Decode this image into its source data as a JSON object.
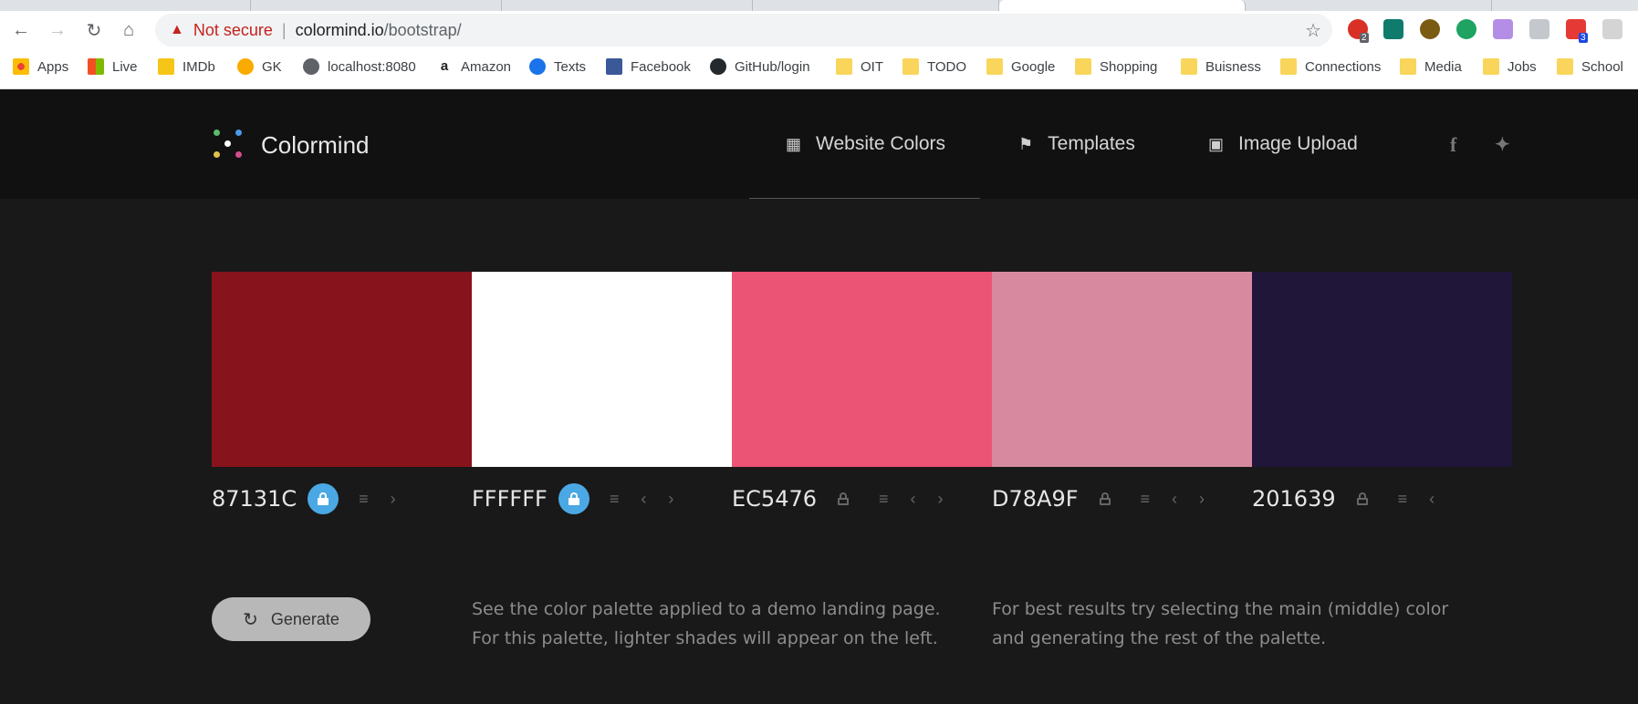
{
  "browser": {
    "security_label": "Not secure",
    "url_host": "colormind.io",
    "url_path": "/bootstrap/",
    "extension_badges": [
      "2",
      "3"
    ]
  },
  "bookmarks": [
    {
      "label": "Apps",
      "icon": "apps-grid-icon"
    },
    {
      "label": "Live",
      "icon": "microsoft-icon"
    },
    {
      "label": "IMDb",
      "icon": "imdb-icon"
    },
    {
      "label": "GK",
      "icon": "bulb-icon"
    },
    {
      "label": "localhost:8080",
      "icon": "globe-icon"
    },
    {
      "label": "Amazon",
      "icon": "amazon-icon"
    },
    {
      "label": "Texts",
      "icon": "messages-icon"
    },
    {
      "label": "Facebook",
      "icon": "facebook-icon"
    },
    {
      "label": "GitHub/login",
      "icon": "github-icon"
    },
    {
      "label": "OIT",
      "icon": "folder-icon"
    },
    {
      "label": "TODO",
      "icon": "folder-icon"
    },
    {
      "label": "Google",
      "icon": "folder-icon"
    },
    {
      "label": "Shopping",
      "icon": "folder-icon"
    },
    {
      "label": "Buisness",
      "icon": "folder-icon"
    },
    {
      "label": "Connections",
      "icon": "folder-icon"
    },
    {
      "label": "Media",
      "icon": "folder-icon"
    },
    {
      "label": "Jobs",
      "icon": "folder-icon"
    },
    {
      "label": "School",
      "icon": "folder-icon"
    }
  ],
  "header": {
    "brand": "Colormind",
    "nav": [
      {
        "label": "Website Colors",
        "icon": "grid-icon"
      },
      {
        "label": "Templates",
        "icon": "bookmark-icon"
      },
      {
        "label": "Image Upload",
        "icon": "camera-icon"
      }
    ],
    "social": [
      "f",
      "twitter-bird"
    ]
  },
  "palette": [
    {
      "hex": "87131C",
      "color": "#87131C",
      "locked": true
    },
    {
      "hex": "FFFFFF",
      "color": "#FFFFFF",
      "locked": true
    },
    {
      "hex": "EC5476",
      "color": "#EC5476",
      "locked": false
    },
    {
      "hex": "D78A9F",
      "color": "#D78A9F",
      "locked": false
    },
    {
      "hex": "201639",
      "color": "#201639",
      "locked": false
    }
  ],
  "generate_label": "Generate",
  "tips": {
    "demo_line1": "See the color palette applied to a demo landing page.",
    "demo_line2": "For this palette, lighter shades will appear on the left.",
    "best_line1": "For best results try selecting the main (middle) color",
    "best_line2": "and generating the rest of the palette."
  }
}
